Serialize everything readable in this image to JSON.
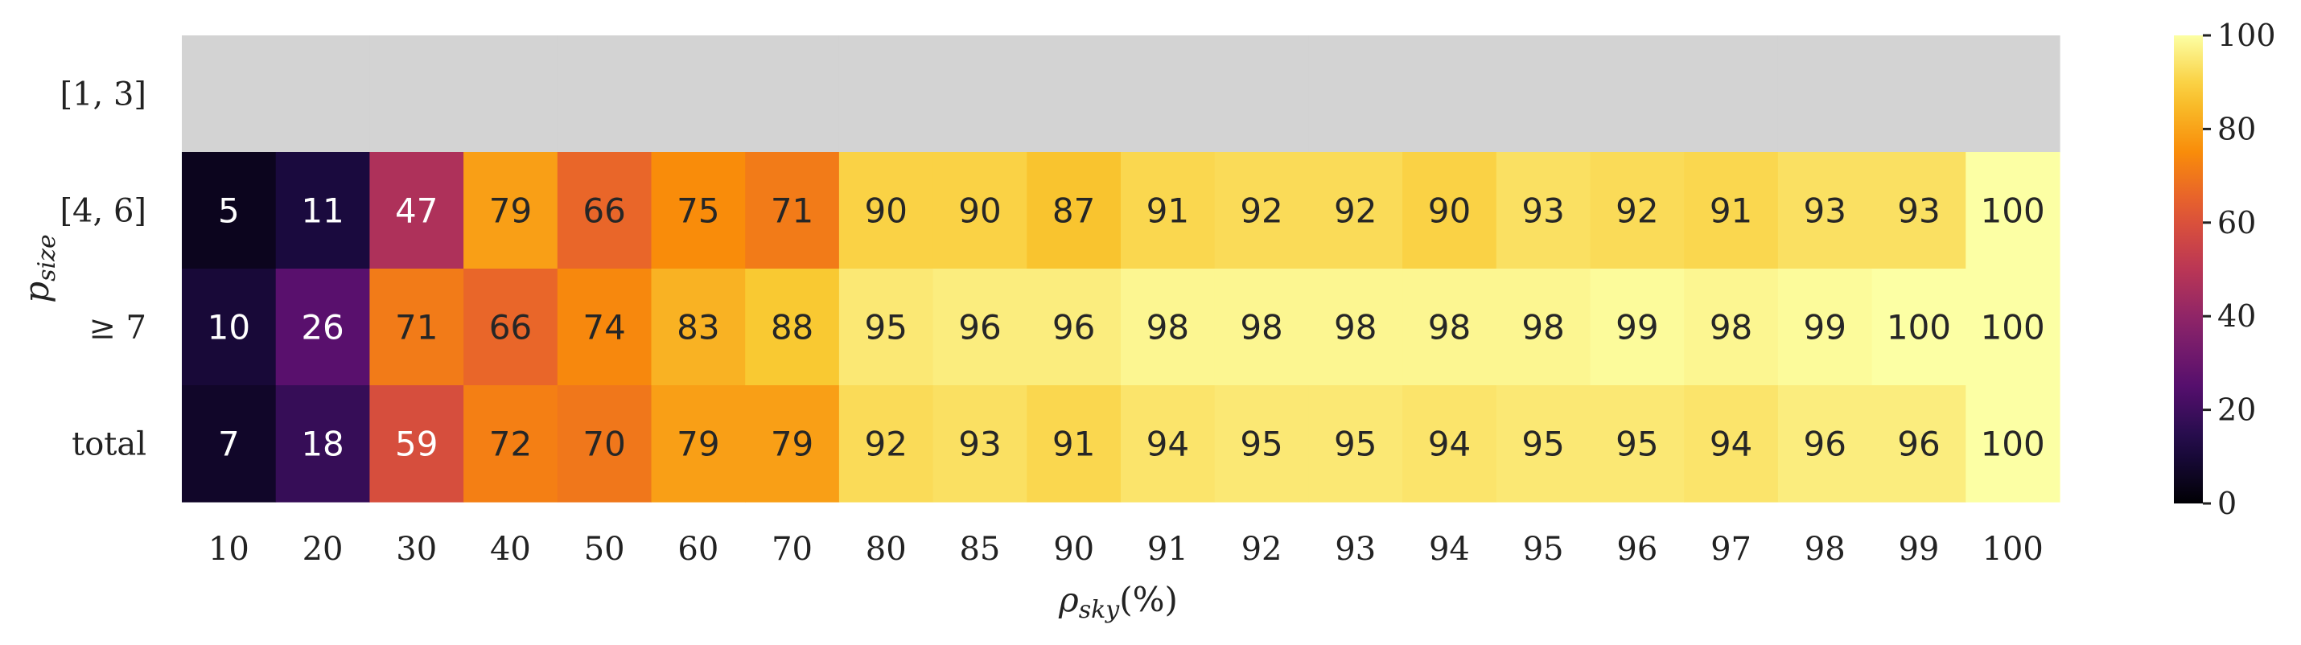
{
  "chart_data": {
    "type": "heatmap",
    "xlabel": "ρsky(%)",
    "ylabel": "psize",
    "x_categories": [
      "10",
      "20",
      "30",
      "40",
      "50",
      "60",
      "70",
      "80",
      "85",
      "90",
      "91",
      "92",
      "93",
      "94",
      "95",
      "96",
      "97",
      "98",
      "99",
      "100"
    ],
    "y_categories": [
      "[1, 3]",
      "[4, 6]",
      "≥ 7",
      "total"
    ],
    "values": [
      [
        null,
        null,
        null,
        null,
        null,
        null,
        null,
        null,
        null,
        null,
        null,
        null,
        null,
        null,
        null,
        null,
        null,
        null,
        null,
        null
      ],
      [
        5,
        11,
        47,
        79,
        66,
        75,
        71,
        90,
        90,
        87,
        91,
        92,
        92,
        90,
        93,
        92,
        91,
        93,
        93,
        100
      ],
      [
        10,
        26,
        71,
        66,
        74,
        83,
        88,
        95,
        96,
        96,
        98,
        98,
        98,
        98,
        98,
        99,
        98,
        99,
        100,
        100
      ],
      [
        7,
        18,
        59,
        72,
        70,
        79,
        79,
        92,
        93,
        91,
        94,
        95,
        95,
        94,
        95,
        95,
        94,
        96,
        96,
        100
      ]
    ],
    "missing_color": "#d3d3d3",
    "colormap": "inferno",
    "colorbar": {
      "range": [
        0,
        100
      ],
      "ticks": [
        "0",
        "20",
        "40",
        "60",
        "80",
        "100"
      ]
    }
  }
}
